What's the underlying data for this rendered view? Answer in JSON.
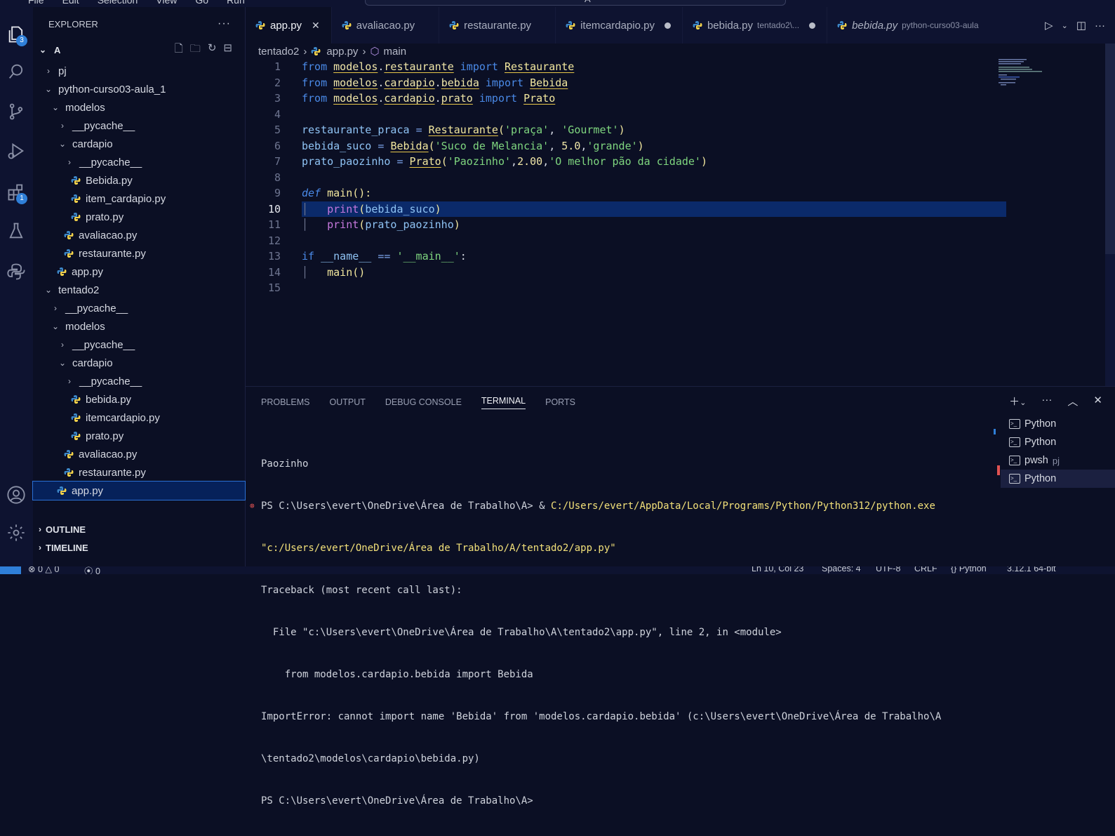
{
  "titlebar": {
    "menu": [
      "File",
      "Edit",
      "Selection",
      "View",
      "Go",
      "Run"
    ],
    "search": "A"
  },
  "activity": {
    "explorer_badge": "3",
    "extensions_badge": "1"
  },
  "sidebar": {
    "title": "EXPLORER",
    "more": "···",
    "root": "A",
    "tree": [
      {
        "label": "pj",
        "depth": 1,
        "kind": "folder",
        "open": false
      },
      {
        "label": "python-curso03-aula_1",
        "depth": 1,
        "kind": "folder",
        "open": true
      },
      {
        "label": "modelos",
        "depth": 2,
        "kind": "folder",
        "open": true
      },
      {
        "label": "__pycache__",
        "depth": 3,
        "kind": "folder",
        "open": false
      },
      {
        "label": "cardapio",
        "depth": 3,
        "kind": "folder",
        "open": true
      },
      {
        "label": "__pycache__",
        "depth": 4,
        "kind": "folder",
        "open": false
      },
      {
        "label": "Bebida.py",
        "depth": 4,
        "kind": "py"
      },
      {
        "label": "item_cardapio.py",
        "depth": 4,
        "kind": "py"
      },
      {
        "label": "prato.py",
        "depth": 4,
        "kind": "py"
      },
      {
        "label": "avaliacao.py",
        "depth": 3,
        "kind": "py"
      },
      {
        "label": "restaurante.py",
        "depth": 3,
        "kind": "py"
      },
      {
        "label": "app.py",
        "depth": 2,
        "kind": "py"
      },
      {
        "label": "tentado2",
        "depth": 1,
        "kind": "folder",
        "open": true
      },
      {
        "label": "__pycache__",
        "depth": 2,
        "kind": "folder",
        "open": false
      },
      {
        "label": "modelos",
        "depth": 2,
        "kind": "folder",
        "open": true
      },
      {
        "label": "__pycache__",
        "depth": 3,
        "kind": "folder",
        "open": false
      },
      {
        "label": "cardapio",
        "depth": 3,
        "kind": "folder",
        "open": true
      },
      {
        "label": "__pycache__",
        "depth": 4,
        "kind": "folder",
        "open": false
      },
      {
        "label": "bebida.py",
        "depth": 4,
        "kind": "py"
      },
      {
        "label": "itemcardapio.py",
        "depth": 4,
        "kind": "py"
      },
      {
        "label": "prato.py",
        "depth": 4,
        "kind": "py"
      },
      {
        "label": "avaliacao.py",
        "depth": 3,
        "kind": "py"
      },
      {
        "label": "restaurante.py",
        "depth": 3,
        "kind": "py"
      },
      {
        "label": "app.py",
        "depth": 2,
        "kind": "py",
        "selected": true
      }
    ],
    "outline": "OUTLINE",
    "timeline": "TIMELINE"
  },
  "tabs": [
    {
      "label": "app.py",
      "active": true,
      "close": "✕"
    },
    {
      "label": "avaliacao.py"
    },
    {
      "label": "restaurante.py"
    },
    {
      "label": "itemcardapio.py",
      "dirty": true
    },
    {
      "label": "bebida.py",
      "desc": "tentado2\\...",
      "dirty": true
    },
    {
      "label": "bebida.py",
      "desc": "python-curso03-aula",
      "italic": true
    }
  ],
  "breadcrumb": {
    "folder": "tentado2",
    "file": "app.py",
    "symbol": "main"
  },
  "editor": {
    "current_line": 10,
    "line_numbers": [
      "1",
      "2",
      "3",
      "4",
      "5",
      "6",
      "7",
      "8",
      "9",
      "10",
      "11",
      "12",
      "13",
      "14",
      "15"
    ]
  },
  "panel": {
    "tabs": [
      "PROBLEMS",
      "OUTPUT",
      "DEBUG CONSOLE",
      "TERMINAL",
      "PORTS"
    ],
    "active_tab": "TERMINAL",
    "terminal": {
      "l1": "Paozinho",
      "l2_prompt": "PS C:\\Users\\evert\\OneDrive\\Área de Trabalho\\A> & ",
      "l2_exe": "C:/Users/evert/AppData/Local/Programs/Python/Python312/python.exe",
      "l3": "\"c:/Users/evert/OneDrive/Área de Trabalho/A/tentado2/app.py\"",
      "l4": "Traceback (most recent call last):",
      "l5": "  File \"c:\\Users\\evert\\OneDrive\\Área de Trabalho\\A\\tentado2\\app.py\", line 2, in <module>",
      "l6": "    from modelos.cardapio.bebida import Bebida",
      "l7": "ImportError: cannot import name 'Bebida' from 'modelos.cardapio.bebida' (c:\\Users\\evert\\OneDrive\\Área de Trabalho\\A",
      "l8": "\\tentado2\\modelos\\cardapio\\bebida.py)",
      "l9": "PS C:\\Users\\evert\\OneDrive\\Área de Trabalho\\A>"
    },
    "terminals": [
      {
        "label": "Python"
      },
      {
        "label": "Python"
      },
      {
        "label": "pwsh",
        "sub": "pj"
      },
      {
        "label": "Python",
        "active": true
      }
    ]
  },
  "status": {
    "errors": "0",
    "warnings": "0",
    "ports": "0",
    "position": "Ln 10, Col 23",
    "spaces": "Spaces: 4",
    "encoding": "UTF-8",
    "eol": "CRLF",
    "language": "Python",
    "interpreter": "3.12.1 64-bit"
  }
}
